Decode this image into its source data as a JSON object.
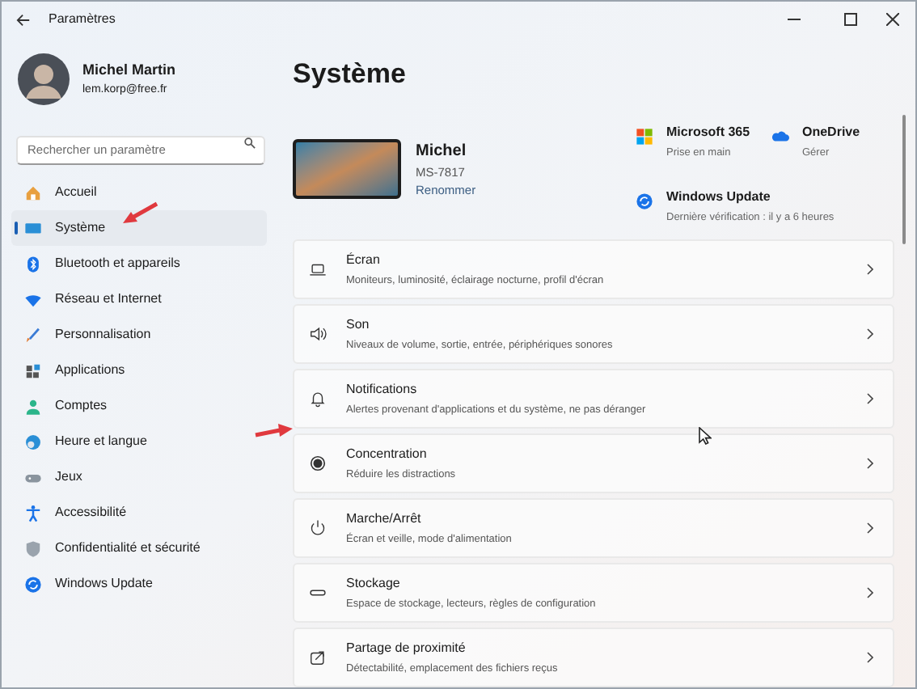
{
  "window": {
    "title": "Paramètres"
  },
  "account": {
    "name": "Michel Martin",
    "email": "lem.korp@free.fr"
  },
  "search": {
    "placeholder": "Rechercher un paramètre"
  },
  "sidebar": {
    "items": [
      {
        "label": "Accueil",
        "selected": false
      },
      {
        "label": "Système",
        "selected": true
      },
      {
        "label": "Bluetooth et appareils",
        "selected": false
      },
      {
        "label": "Réseau et Internet",
        "selected": false
      },
      {
        "label": "Personnalisation",
        "selected": false
      },
      {
        "label": "Applications",
        "selected": false
      },
      {
        "label": "Comptes",
        "selected": false
      },
      {
        "label": "Heure et langue",
        "selected": false
      },
      {
        "label": "Jeux",
        "selected": false
      },
      {
        "label": "Accessibilité",
        "selected": false
      },
      {
        "label": "Confidentialité et sécurité",
        "selected": false
      },
      {
        "label": "Windows Update",
        "selected": false
      }
    ]
  },
  "page": {
    "title": "Système"
  },
  "device": {
    "name": "Michel",
    "model": "MS-7817",
    "rename_link": "Renommer"
  },
  "quick_links": [
    {
      "title": "Microsoft 365",
      "subtitle": "Prise en main"
    },
    {
      "title": "OneDrive",
      "subtitle": "Gérer"
    },
    {
      "title": "Windows Update",
      "subtitle": "Dernière vérification : il y a 6 heures"
    }
  ],
  "settings": [
    {
      "title": "Écran",
      "subtitle": "Moniteurs, luminosité, éclairage nocturne, profil d'écran"
    },
    {
      "title": "Son",
      "subtitle": "Niveaux de volume, sortie, entrée, périphériques sonores"
    },
    {
      "title": "Notifications",
      "subtitle": "Alertes provenant d'applications et du système, ne pas déranger"
    },
    {
      "title": "Concentration",
      "subtitle": "Réduire les distractions"
    },
    {
      "title": "Marche/Arrêt",
      "subtitle": "Écran et veille, mode d'alimentation"
    },
    {
      "title": "Stockage",
      "subtitle": "Espace de stockage, lecteurs, règles de configuration"
    },
    {
      "title": "Partage de proximité",
      "subtitle": "Détectabilité, emplacement des fichiers reçus"
    }
  ]
}
